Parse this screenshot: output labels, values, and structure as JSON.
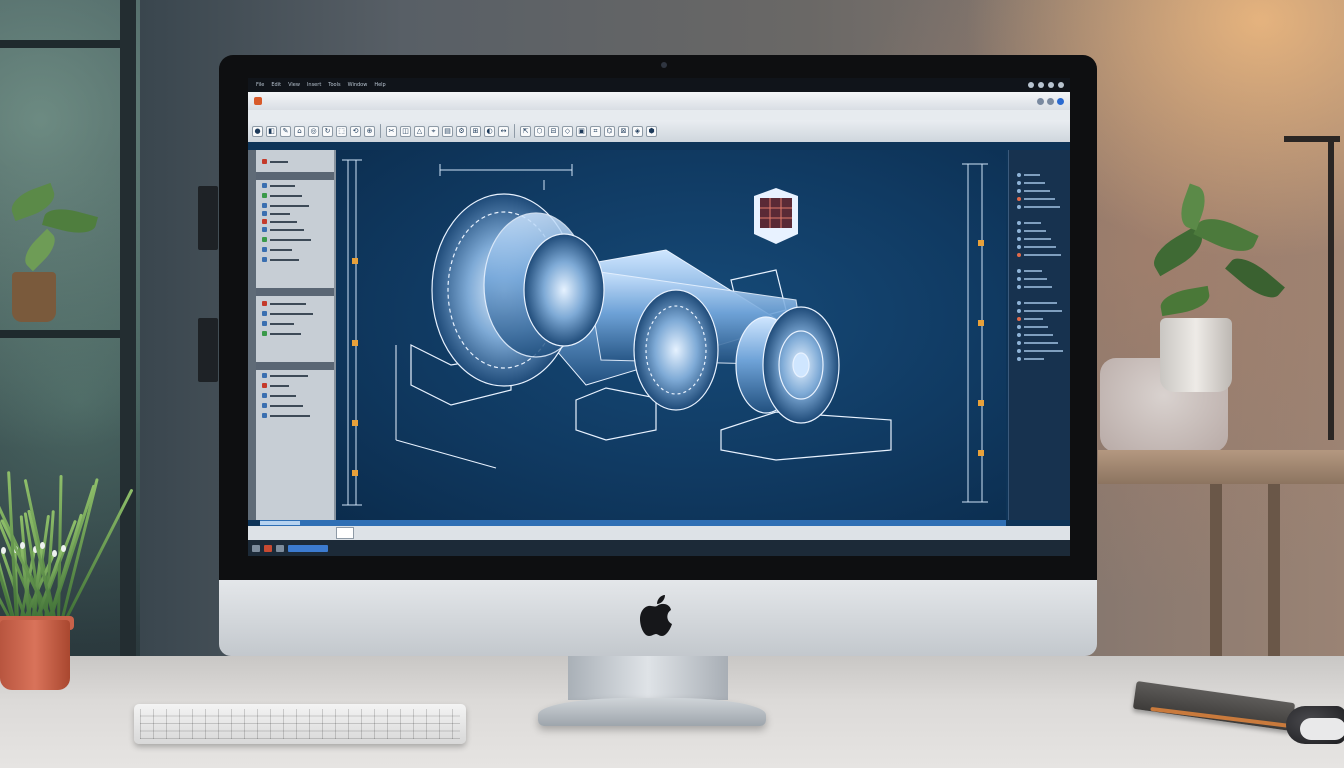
{
  "scene": "desk",
  "cad_app": {
    "menubar": {
      "items": [
        "File",
        "Edit",
        "View",
        "Insert",
        "Tools",
        "Window",
        "Help"
      ]
    },
    "titlebar": {
      "app_badge": "",
      "doc_title": ""
    },
    "ribbon": {
      "tabs": [
        "",
        "",
        "",
        "",
        "",
        "",
        "",
        ""
      ]
    },
    "left_panel": {
      "headers": [
        "",
        "",
        ""
      ]
    },
    "right_panel": {
      "header": ""
    },
    "command_line": {
      "text": ""
    },
    "statusbar": {
      "text": ""
    },
    "colors": {
      "canvas": "#103a62",
      "accent": "#2f6fb4",
      "wireframe": "#e8f2ff"
    }
  },
  "device": {
    "logo": "apple-logo"
  }
}
